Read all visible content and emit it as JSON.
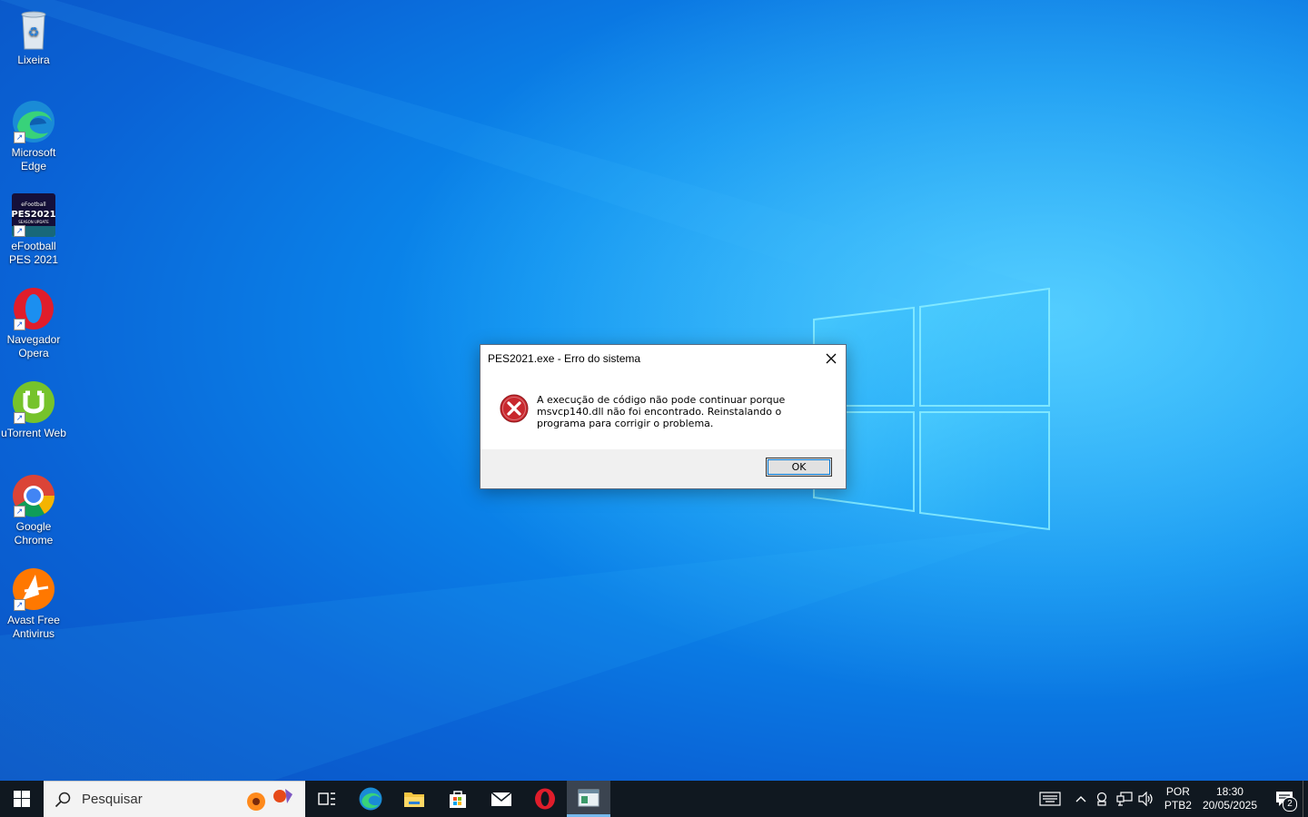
{
  "desktop": {
    "icons": [
      {
        "label": "Lixeira"
      },
      {
        "label": "Microsoft Edge"
      },
      {
        "label": "eFootball PES 2021"
      },
      {
        "label": "Navegador Opera"
      },
      {
        "label": "uTorrent Web"
      },
      {
        "label": "Google Chrome"
      },
      {
        "label": "Avast Free Antivirus"
      }
    ],
    "pes_icon_text": {
      "brand": "eFootball",
      "logo": "PES2021",
      "tag": "SEASON UPDATE"
    }
  },
  "dialog": {
    "title": "PES2021.exe - Erro do sistema",
    "message": "A execução de código não pode continuar porque msvcp140.dll não foi encontrado. Reinstalando o programa para corrigir o problema.",
    "ok_label": "OK"
  },
  "taskbar": {
    "search_placeholder": "Pesquisar",
    "language_line1": "POR",
    "language_line2": "PTB2",
    "time": "18:30",
    "date": "20/05/2025",
    "notifications_count": "2"
  },
  "colors": {
    "desktop_blue": "#0a8ff0",
    "taskbar": "#101820",
    "error_red": "#c8282e",
    "accent": "#0078d7"
  }
}
